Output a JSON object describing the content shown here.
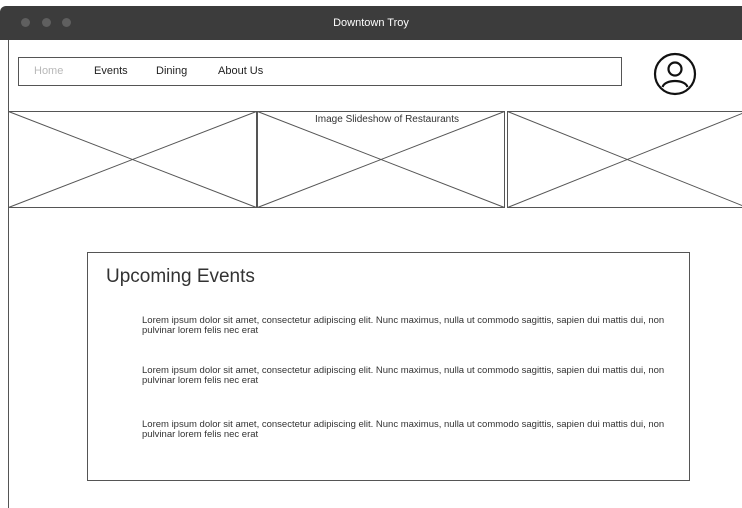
{
  "window": {
    "title": "Downtown Troy",
    "controls": [
      "close",
      "minimize",
      "maximize"
    ]
  },
  "nav": {
    "items": [
      {
        "label": "Home",
        "active": true
      },
      {
        "label": "Events",
        "active": false
      },
      {
        "label": "Dining",
        "active": false
      },
      {
        "label": "About Us",
        "active": false
      }
    ],
    "account_icon": "user-circle-icon"
  },
  "slideshow": {
    "caption": "Image Slideshow of Restaurants",
    "panels": [
      "image-placeholder",
      "image-placeholder",
      "image-placeholder"
    ]
  },
  "events": {
    "heading": "Upcoming Events",
    "items": [
      "Lorem ipsum dolor sit amet, consectetur adipiscing elit. Nunc maximus, nulla ut commodo sagittis, sapien dui mattis dui, non pulvinar lorem felis nec erat",
      "Lorem ipsum dolor sit amet, consectetur adipiscing elit. Nunc maximus, nulla ut commodo sagittis, sapien dui mattis dui, non pulvinar lorem felis nec erat",
      "Lorem ipsum dolor sit amet, consectetur adipiscing elit. Nunc maximus, nulla ut commodo sagittis, sapien dui mattis dui, non pulvinar lorem felis nec erat"
    ]
  },
  "colors": {
    "titlebar": "#3c3c3c",
    "outline": "#555555",
    "nav_active": "#b8b8b8",
    "text": "#333333"
  }
}
